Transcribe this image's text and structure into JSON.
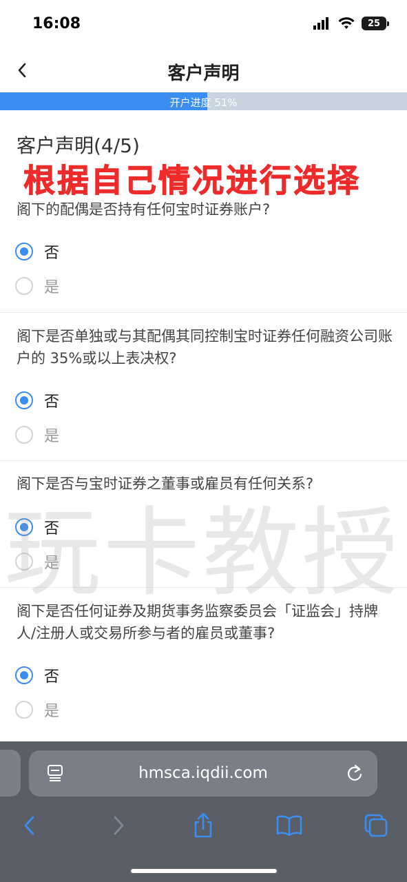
{
  "status_bar": {
    "time": "16:08",
    "battery": "25"
  },
  "nav": {
    "title": "客户声明"
  },
  "progress": {
    "label": "开户进度 51%",
    "fraction": 0.51,
    "fill_color": "#3b8df0",
    "track_color": "#c8d4e0"
  },
  "section": {
    "title": "客户声明(4/5)"
  },
  "overlay_banner": {
    "text": "根据自己情况进行选择",
    "color": "#ee2b2b"
  },
  "questions": [
    {
      "text": "阁下的配偶是否持有任何宝时证券账户?",
      "options": [
        {
          "label": "否",
          "checked": true
        },
        {
          "label": "是",
          "checked": false
        }
      ]
    },
    {
      "text": "阁下是否单独或与其配偶其同控制宝时证券任何融资公司账户的 35%或以上表决权?",
      "options": [
        {
          "label": "否",
          "checked": true
        },
        {
          "label": "是",
          "checked": false
        }
      ]
    },
    {
      "text": "阁下是否与宝时证券之董事或雇员有任何关系?",
      "options": [
        {
          "label": "否",
          "checked": true
        },
        {
          "label": "是",
          "checked": false
        }
      ]
    },
    {
      "text": "阁下是否任何证券及期货事务监察委员会「证监会」持牌人/注册人或交易所参与者的雇员或董事?",
      "options": [
        {
          "label": "否",
          "checked": true
        },
        {
          "label": "是",
          "checked": false
        }
      ]
    }
  ],
  "watermark": {
    "text": "玩卡教授"
  },
  "browser": {
    "url": "hmsca.iqdii.com"
  },
  "icons": {
    "back": "chevron-left-icon",
    "signal": "cellular-signal-icon",
    "wifi": "wifi-icon",
    "battery": "battery-icon",
    "reader": "reader-mode-icon",
    "reload": "reload-icon",
    "nav_back": "browser-back-icon",
    "nav_forward": "browser-forward-icon",
    "share": "share-icon",
    "bookmarks": "bookmarks-icon",
    "tabs": "tabs-icon"
  },
  "accent_color": "#3b8df0"
}
